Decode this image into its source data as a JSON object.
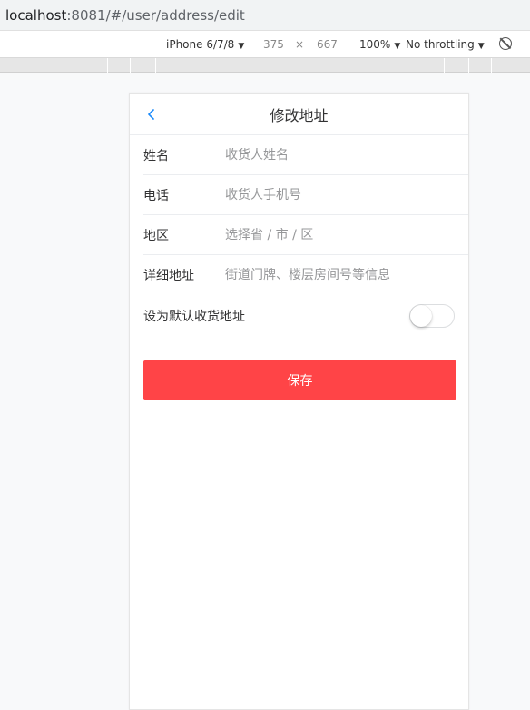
{
  "browser": {
    "url_host": "localhost",
    "url_rest": ":8081/#/user/address/edit"
  },
  "devtools": {
    "device": "iPhone 6/7/8",
    "width": "375",
    "times": "×",
    "height": "667",
    "zoom": "100%",
    "throttling": "No throttling",
    "caret": "▼"
  },
  "page": {
    "title": "修改地址",
    "fields": [
      {
        "label": "姓名",
        "placeholder": "收货人姓名",
        "value": ""
      },
      {
        "label": "电话",
        "placeholder": "收货人手机号",
        "value": ""
      },
      {
        "label": "地区",
        "placeholder": "选择省 / 市 / 区",
        "value": ""
      },
      {
        "label": "详细地址",
        "placeholder": "街道门牌、楼层房间号等信息",
        "value": ""
      }
    ],
    "default_label": "设为默认收货地址",
    "default_on": false,
    "save_label": "保存"
  },
  "colors": {
    "accent": "#ff4447",
    "back_icon": "#1989fa"
  }
}
